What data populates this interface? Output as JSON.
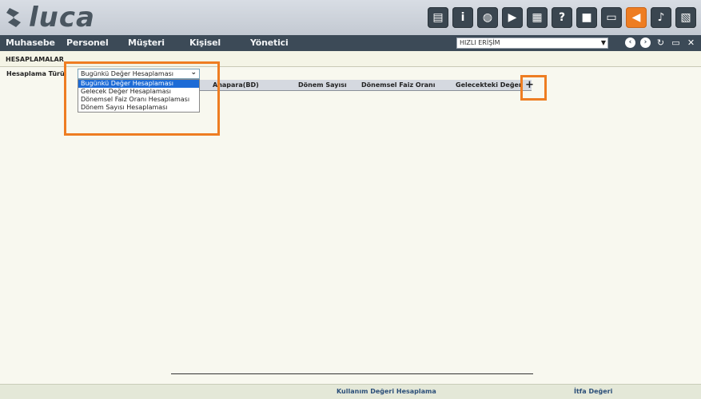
{
  "app": {
    "logo_text": "luca"
  },
  "toolbar": {
    "icons": [
      {
        "name": "book-icon",
        "glyph": "▤"
      },
      {
        "name": "info-icon",
        "glyph": "i"
      },
      {
        "name": "globe-icon",
        "glyph": "◍"
      },
      {
        "name": "youtube-icon",
        "glyph": "▶"
      },
      {
        "name": "calculator-icon",
        "glyph": "▦"
      },
      {
        "name": "help-icon",
        "glyph": "?"
      },
      {
        "name": "video-icon",
        "glyph": "■"
      },
      {
        "name": "monitor-icon",
        "glyph": "▭"
      },
      {
        "name": "megaphone-icon",
        "glyph": "◀"
      },
      {
        "name": "bell-icon",
        "glyph": "♪"
      },
      {
        "name": "notebook-icon",
        "glyph": "▧"
      }
    ],
    "accent_color": "#ee7d22"
  },
  "nav": {
    "items": [
      "Muhasebe",
      "Personel",
      "Müşteri",
      "Kişisel",
      "Yönetici"
    ],
    "quick_access": "HIZLI ERİŞİM"
  },
  "section": {
    "title": "HESAPLAMALAR"
  },
  "form": {
    "label": "Hesaplama Türü",
    "selected": "Bugünkü Değer Hesaplaması",
    "options": [
      "Bugünkü Değer Hesaplaması",
      "Gelecek Değer Hesaplaması",
      "Dönemsel Faiz Oranı Hesaplaması",
      "Dönem Sayısı Hesaplaması"
    ]
  },
  "table": {
    "headers": [
      "Anapara(BD)",
      "Dönem Sayısı",
      "Dönemsel Faiz Oranı",
      "Gelecekteki Değer"
    ],
    "add_label": "+"
  },
  "footer": {
    "links": [
      "Kullanım Değeri Hesaplama",
      "İtfa Değeri"
    ]
  }
}
